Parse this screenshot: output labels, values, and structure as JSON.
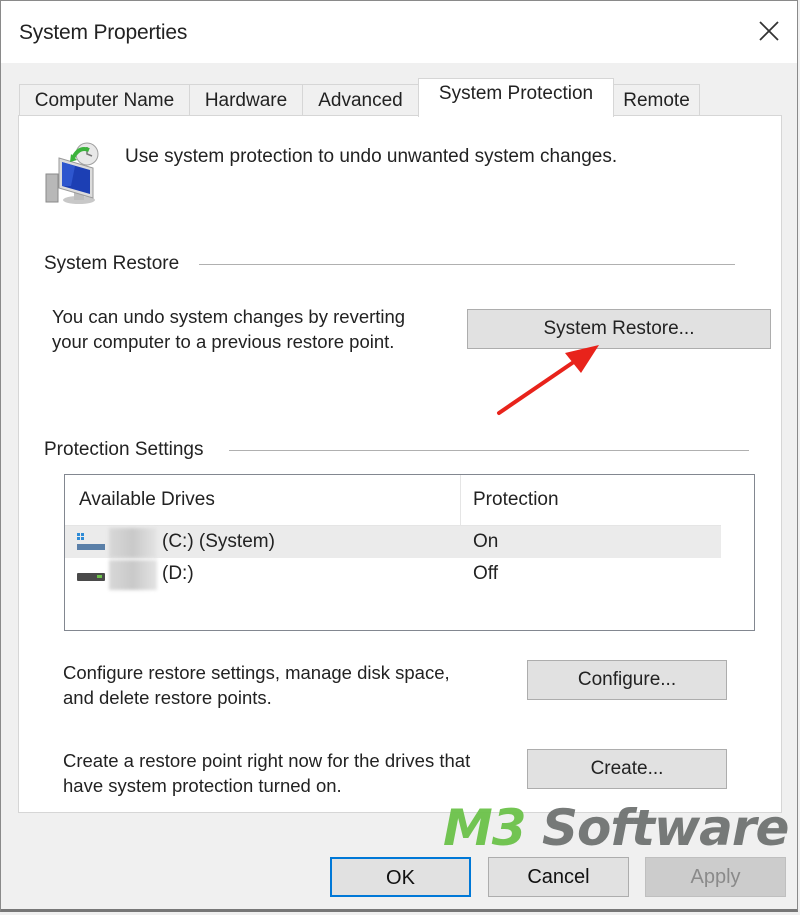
{
  "window": {
    "title": "System Properties",
    "close_icon": "close-icon"
  },
  "tabs": [
    {
      "label": "Computer Name",
      "active": false
    },
    {
      "label": "Hardware",
      "active": false
    },
    {
      "label": "Advanced",
      "active": false
    },
    {
      "label": "System Protection",
      "active": true
    },
    {
      "label": "Remote",
      "active": false
    }
  ],
  "intro": {
    "icon": "system-protection-icon",
    "text": "Use system protection to undo unwanted system changes."
  },
  "system_restore": {
    "group_label": "System Restore",
    "description_line1": "You can undo system changes by reverting",
    "description_line2": "your computer to a previous restore point.",
    "button_label": "System Restore..."
  },
  "protection_settings": {
    "group_label": "Protection Settings",
    "columns": [
      "Available Drives",
      "Protection"
    ],
    "drives": [
      {
        "name": "(C:) (System)",
        "protection": "On",
        "icon": "system-drive-icon",
        "selected": true
      },
      {
        "name": "(D:)",
        "protection": "Off",
        "icon": "hard-drive-icon",
        "selected": false
      }
    ],
    "configure_desc_line1": "Configure restore settings, manage disk space,",
    "configure_desc_line2": "and delete restore points.",
    "configure_label": "Configure...",
    "create_desc_line1": "Create a restore point right now for the drives that",
    "create_desc_line2": "have system protection turned on.",
    "create_label": "Create..."
  },
  "footer": {
    "ok_label": "OK",
    "cancel_label": "Cancel",
    "apply_label": "Apply"
  },
  "annotation": {
    "arrow_color": "#e8231b"
  },
  "watermark": {
    "brand_part1": "M3",
    "brand_part2": " Software",
    "color1": "#6cc24a",
    "color2": "#707372"
  }
}
